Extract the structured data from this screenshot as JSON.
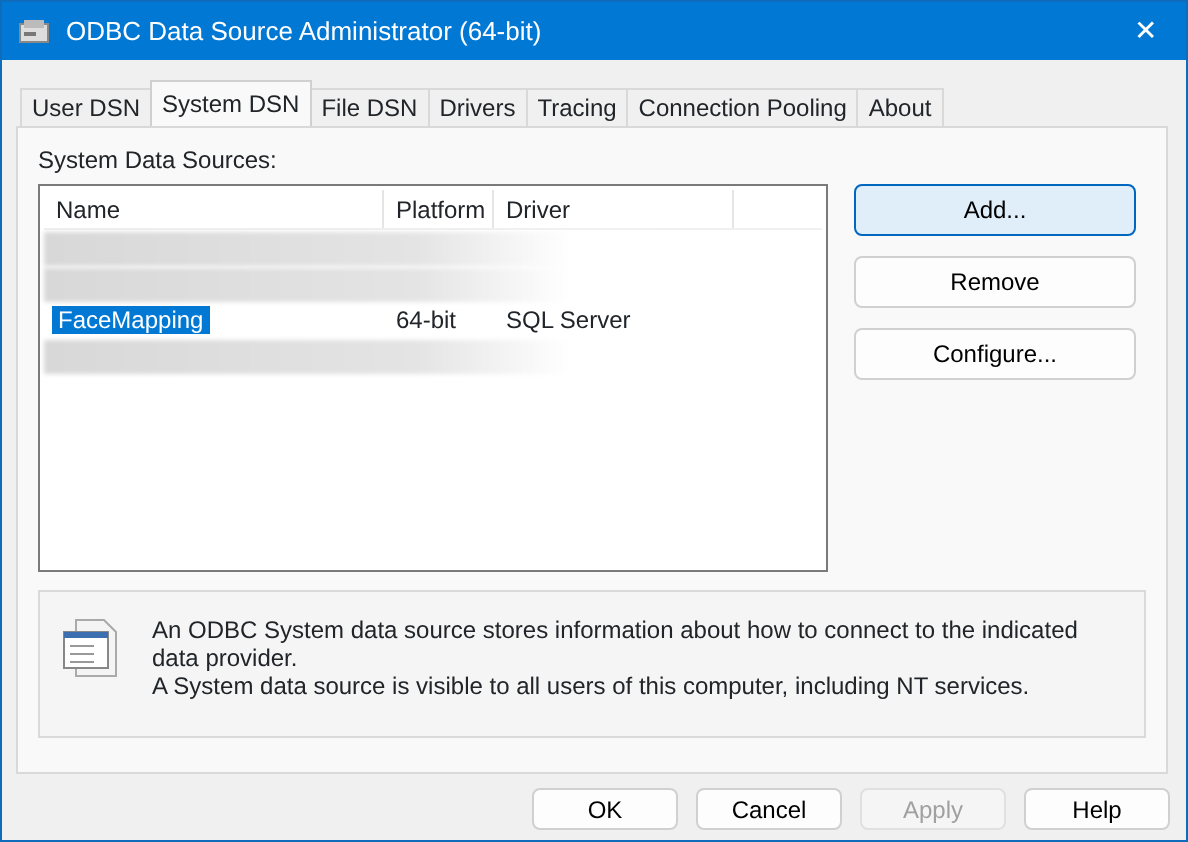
{
  "window": {
    "title": "ODBC Data Source Administrator (64-bit)",
    "close": "✕"
  },
  "tabs": [
    {
      "label": "User DSN",
      "selected": false
    },
    {
      "label": "System DSN",
      "selected": true
    },
    {
      "label": "File DSN",
      "selected": false
    },
    {
      "label": "Drivers",
      "selected": false
    },
    {
      "label": "Tracing",
      "selected": false
    },
    {
      "label": "Connection Pooling",
      "selected": false
    },
    {
      "label": "About",
      "selected": false
    }
  ],
  "list": {
    "label": "System Data Sources:",
    "columns": [
      "Name",
      "Platform",
      "Driver"
    ],
    "rows": [
      {
        "kind": "blurred"
      },
      {
        "kind": "blurred"
      },
      {
        "kind": "entry",
        "name": "FaceMapping",
        "platform": "64-bit",
        "driver": "SQL Server",
        "selected": true
      },
      {
        "kind": "blurred"
      }
    ]
  },
  "side_buttons": [
    {
      "label": "Add...",
      "hover": true
    },
    {
      "label": "Remove",
      "hover": false
    },
    {
      "label": "Configure...",
      "hover": false
    }
  ],
  "info": "An ODBC System data source stores information about how to connect to the indicated data provider.\nA System data source is visible to all users of this computer, including NT services.",
  "buttons": [
    {
      "label": "OK",
      "disabled": false
    },
    {
      "label": "Cancel",
      "disabled": false
    },
    {
      "label": "Apply",
      "disabled": true
    },
    {
      "label": "Help",
      "disabled": false
    }
  ]
}
